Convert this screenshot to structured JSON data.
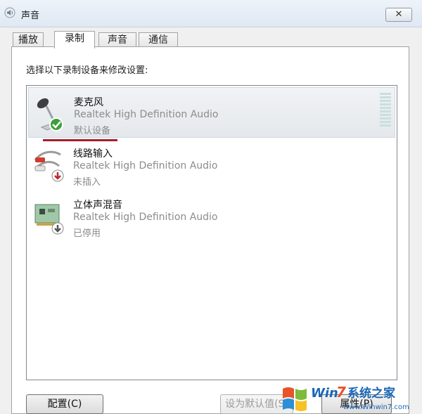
{
  "window": {
    "title": "声音",
    "close_label": "✕"
  },
  "tabs": [
    {
      "label": "播放",
      "active": false
    },
    {
      "label": "录制",
      "active": true
    },
    {
      "label": "声音",
      "active": false
    },
    {
      "label": "通信",
      "active": false
    }
  ],
  "instruction": "选择以下录制设备来修改设置:",
  "devices": [
    {
      "name": "麦克风",
      "driver": "Realtek High Definition Audio",
      "status": "默认设备",
      "icon": "microphone-icon",
      "badge": "green-check-icon",
      "selected": true
    },
    {
      "name": "线路输入",
      "driver": "Realtek High Definition Audio",
      "status": "未插入",
      "icon": "line-in-cable-icon",
      "badge": "red-down-arrow-icon",
      "selected": false
    },
    {
      "name": "立体声混音",
      "driver": "Realtek High Definition Audio",
      "status": "已停用",
      "icon": "sound-card-icon",
      "badge": "gray-down-arrow-icon",
      "selected": false
    }
  ],
  "buttons": {
    "configure": "配置(C)",
    "set_default": "设为默认值(S)",
    "properties": "属性(P)"
  },
  "watermark": {
    "brand_win": "Win",
    "brand_7": "7",
    "brand_cn": "系统之家",
    "url": "www.Winwin7.com"
  },
  "colors": {
    "accent_underline": "#a31f2f",
    "status_gray": "#8c8c8c",
    "check_green": "#3aa03a",
    "arrow_red": "#c0262c"
  }
}
